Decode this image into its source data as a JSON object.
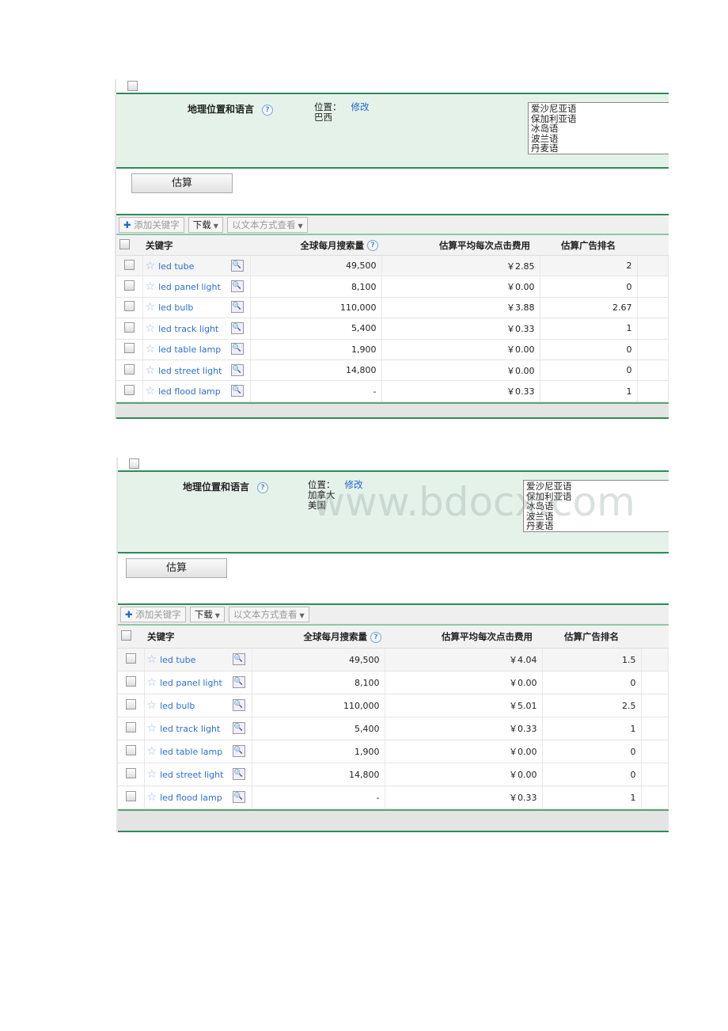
{
  "watermark": "www.bdocx.com",
  "colors": {
    "accent_green": "#2e8b57",
    "panel_bg": "#e5f2ea",
    "link": "#2a6fd6"
  },
  "panels": [
    {
      "geo_label": "地理位置和语言",
      "location_label": "位置：",
      "edit_link": "修改",
      "locations": [
        "巴西"
      ],
      "languages": [
        "爱沙尼亚语",
        "保加利亚语",
        "冰岛语",
        "波兰语",
        "丹麦语"
      ],
      "estimate_button": "估算",
      "toolbar": {
        "add_keyword": "添加关键字",
        "download": "下载",
        "view_as_text": "以文本方式查看"
      },
      "columns": [
        "关键字",
        "全球每月搜索量",
        "估算平均每次点击费用",
        "估算广告排名"
      ],
      "rows": [
        {
          "keyword": "led tube",
          "volume": "49,500",
          "cpc": "￥2.85",
          "rank": "2"
        },
        {
          "keyword": "led panel light",
          "volume": "8,100",
          "cpc": "￥0.00",
          "rank": "0"
        },
        {
          "keyword": "led bulb",
          "volume": "110,000",
          "cpc": "￥3.88",
          "rank": "2.67"
        },
        {
          "keyword": "led track light",
          "volume": "5,400",
          "cpc": "￥0.33",
          "rank": "1"
        },
        {
          "keyword": "led table lamp",
          "volume": "1,900",
          "cpc": "￥0.00",
          "rank": "0"
        },
        {
          "keyword": "led street light",
          "volume": "14,800",
          "cpc": "￥0.00",
          "rank": "0"
        },
        {
          "keyword": "led flood lamp",
          "volume": "-",
          "cpc": "￥0.33",
          "rank": "1"
        }
      ]
    },
    {
      "geo_label": "地理位置和语言",
      "location_label": "位置：",
      "edit_link": "修改",
      "locations": [
        "加拿大",
        "美国"
      ],
      "languages": [
        "爱沙尼亚语",
        "保加利亚语",
        "冰岛语",
        "波兰语",
        "丹麦语"
      ],
      "estimate_button": "估算",
      "toolbar": {
        "add_keyword": "添加关键字",
        "download": "下载",
        "view_as_text": "以文本方式查看"
      },
      "columns": [
        "关键字",
        "全球每月搜索量",
        "估算平均每次点击费用",
        "估算广告排名"
      ],
      "rows": [
        {
          "keyword": "led tube",
          "volume": "49,500",
          "cpc": "￥4.04",
          "rank": "1.5"
        },
        {
          "keyword": "led panel light",
          "volume": "8,100",
          "cpc": "￥0.00",
          "rank": "0"
        },
        {
          "keyword": "led bulb",
          "volume": "110,000",
          "cpc": "￥5.01",
          "rank": "2.5"
        },
        {
          "keyword": "led track light",
          "volume": "5,400",
          "cpc": "￥0.33",
          "rank": "1"
        },
        {
          "keyword": "led table lamp",
          "volume": "1,900",
          "cpc": "￥0.00",
          "rank": "0"
        },
        {
          "keyword": "led street light",
          "volume": "14,800",
          "cpc": "￥0.00",
          "rank": "0"
        },
        {
          "keyword": "led flood lamp",
          "volume": "-",
          "cpc": "￥0.33",
          "rank": "1"
        }
      ]
    }
  ]
}
